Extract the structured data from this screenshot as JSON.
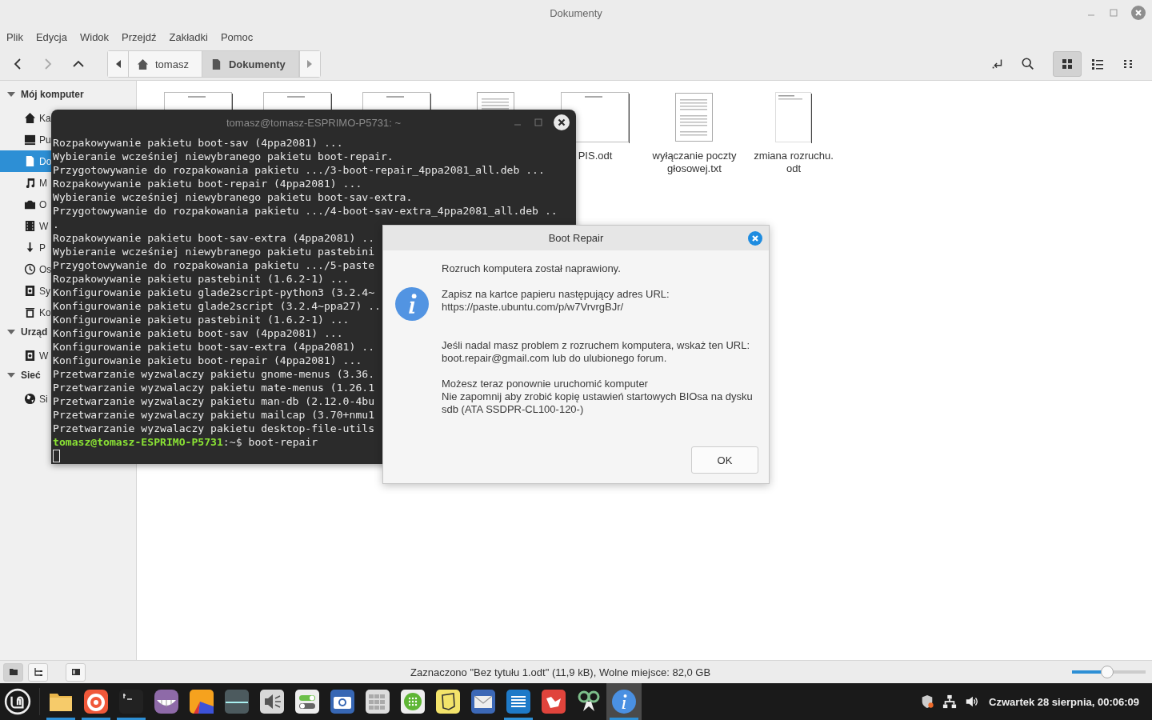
{
  "window": {
    "title": "Dokumenty"
  },
  "menu": [
    "Plik",
    "Edycja",
    "Widok",
    "Przejdź",
    "Zakładki",
    "Pomoc"
  ],
  "path_bar": [
    {
      "label": "tomasz",
      "kind": "home",
      "selected": false
    },
    {
      "label": "Dokumenty",
      "kind": "document",
      "selected": true
    }
  ],
  "view_buttons": [
    {
      "kind": "icons",
      "selected": true
    },
    {
      "kind": "list",
      "selected": false
    },
    {
      "kind": "compact",
      "selected": false
    }
  ],
  "sidebar": [
    {
      "title": "Mój komputer",
      "expanded": true,
      "items": [
        {
          "label": "Ka",
          "kind": "home",
          "selected": false
        },
        {
          "label": "Pu",
          "kind": "desktop",
          "selected": false
        },
        {
          "label": "Do",
          "kind": "document",
          "selected": true
        },
        {
          "label": "M",
          "kind": "music",
          "selected": false
        },
        {
          "label": "O",
          "kind": "camera",
          "selected": false
        },
        {
          "label": "W",
          "kind": "film",
          "selected": false
        },
        {
          "label": "P",
          "kind": "download",
          "selected": false
        },
        {
          "label": "Os",
          "kind": "clock",
          "selected": false
        },
        {
          "label": "Sy",
          "kind": "drive",
          "selected": false
        },
        {
          "label": "Ko",
          "kind": "trash",
          "selected": false
        }
      ]
    },
    {
      "title": "Urząd",
      "expanded": true,
      "items": [
        {
          "label": "W",
          "kind": "drive",
          "selected": false
        }
      ]
    },
    {
      "title": "Sieć",
      "expanded": true,
      "items": [
        {
          "label": "Si",
          "kind": "globe",
          "selected": false
        }
      ]
    }
  ],
  "files": [
    {
      "kind": "wide-top"
    },
    {
      "kind": "wide-top"
    },
    {
      "kind": "wide-top"
    },
    {
      "kind": "page-top"
    },
    {
      "kind": "wide",
      "name": [
        "PIS.odt"
      ]
    },
    {
      "kind": "page",
      "name": [
        "wyłączanie poczty",
        "głosowej.txt"
      ]
    },
    {
      "kind": "sparse",
      "name": [
        "zmiana rozruchu.",
        "odt"
      ]
    }
  ],
  "terminal": {
    "title": "tomasz@tomasz-ESPRIMO-P5731: ~",
    "lines": [
      "Rozpakowywanie pakietu boot-sav (4ppa2081) ...",
      "Wybieranie wcześniej niewybranego pakietu boot-repair.",
      "Przygotowywanie do rozpakowania pakietu .../3-boot-repair_4ppa2081_all.deb ...",
      "Rozpakowywanie pakietu boot-repair (4ppa2081) ...",
      "Wybieranie wcześniej niewybranego pakietu boot-sav-extra.",
      "Przygotowywanie do rozpakowania pakietu .../4-boot-sav-extra_4ppa2081_all.deb ..",
      ".",
      "Rozpakowywanie pakietu boot-sav-extra (4ppa2081) ..",
      "Wybieranie wcześniej niewybranego pakietu pastebini",
      "Przygotowywanie do rozpakowania pakietu .../5-paste",
      "Rozpakowywanie pakietu pastebinit (1.6.2-1) ...",
      "Konfigurowanie pakietu glade2script-python3 (3.2.4~",
      "Konfigurowanie pakietu glade2script (3.2.4~ppa27) ..",
      "Konfigurowanie pakietu pastebinit (1.6.2-1) ...",
      "Konfigurowanie pakietu boot-sav (4ppa2081) ...",
      "Konfigurowanie pakietu boot-sav-extra (4ppa2081) ..",
      "Konfigurowanie pakietu boot-repair (4ppa2081) ...",
      "Przetwarzanie wyzwalaczy pakietu gnome-menus (3.36.",
      "Przetwarzanie wyzwalaczy pakietu mate-menus (1.26.1",
      "Przetwarzanie wyzwalaczy pakietu man-db (2.12.0-4bu",
      "Przetwarzanie wyzwalaczy pakietu mailcap (3.70+nmu1",
      "Przetwarzanie wyzwalaczy pakietu desktop-file-utils"
    ],
    "prompt": {
      "user": "tomasz@tomasz-ESPRIMO-P5731",
      "path": ":~$",
      "command": "boot-repair"
    }
  },
  "dialog": {
    "title": "Boot Repair",
    "paragraphs": [
      [
        "Rozruch komputera został naprawiony."
      ],
      [
        "Zapisz na kartce papieru następujący adres URL:",
        "https://paste.ubuntu.com/p/w7VrvrgBJr/"
      ],
      [
        "Jeśli nadal masz problem z rozruchem komputera, wskaż ten URL:",
        "boot.repair@gmail.com lub do ulubionego forum."
      ],
      [
        "Możesz teraz ponownie uruchomić komputer",
        "Nie zapomnij aby zrobić kopię ustawień startowych BIOsa na dysku",
        "sdb (ATA SSDPR-CL100-120-)"
      ]
    ],
    "button": "OK"
  },
  "status_bar": {
    "buttons": [
      {
        "kind": "places",
        "selected": true
      },
      {
        "kind": "tree",
        "selected": false
      },
      {
        "kind": "sidebar",
        "selected": false
      }
    ],
    "text": "Zaznaczono \"Bez tytułu 1.odt\" (11,9 kB), Wolne miejsce: 82,0 GB",
    "zoom": {
      "level": 0.48
    }
  },
  "taskbar": {
    "apps": [
      {
        "kind": "folder",
        "running": true,
        "active": false
      },
      {
        "kind": "fox",
        "running": true,
        "active": false
      },
      {
        "kind": "terminal",
        "running": true,
        "active": false
      },
      {
        "kind": "teeth",
        "running": false,
        "active": false
      },
      {
        "kind": "shapes",
        "running": false,
        "active": false
      },
      {
        "kind": "monitor",
        "running": false,
        "active": false
      },
      {
        "kind": "speaker",
        "running": false,
        "active": false
      },
      {
        "kind": "toggles",
        "running": false,
        "active": false
      },
      {
        "kind": "camera",
        "running": false,
        "active": false
      },
      {
        "kind": "grid",
        "running": false,
        "active": false
      },
      {
        "kind": "dots",
        "running": false,
        "active": false
      },
      {
        "kind": "note",
        "running": false,
        "active": false
      },
      {
        "kind": "mail",
        "running": false,
        "active": false
      },
      {
        "kind": "editor",
        "running": true,
        "active": false
      },
      {
        "kind": "redtile",
        "running": false,
        "active": false
      },
      {
        "kind": "glasses",
        "running": false,
        "active": false
      },
      {
        "kind": "info",
        "running": true,
        "active": true
      }
    ],
    "tray": [
      {
        "kind": "shield"
      },
      {
        "kind": "network"
      },
      {
        "kind": "volume"
      }
    ],
    "clock": "Czwartek 28 sierpnia, 00:06:09"
  }
}
